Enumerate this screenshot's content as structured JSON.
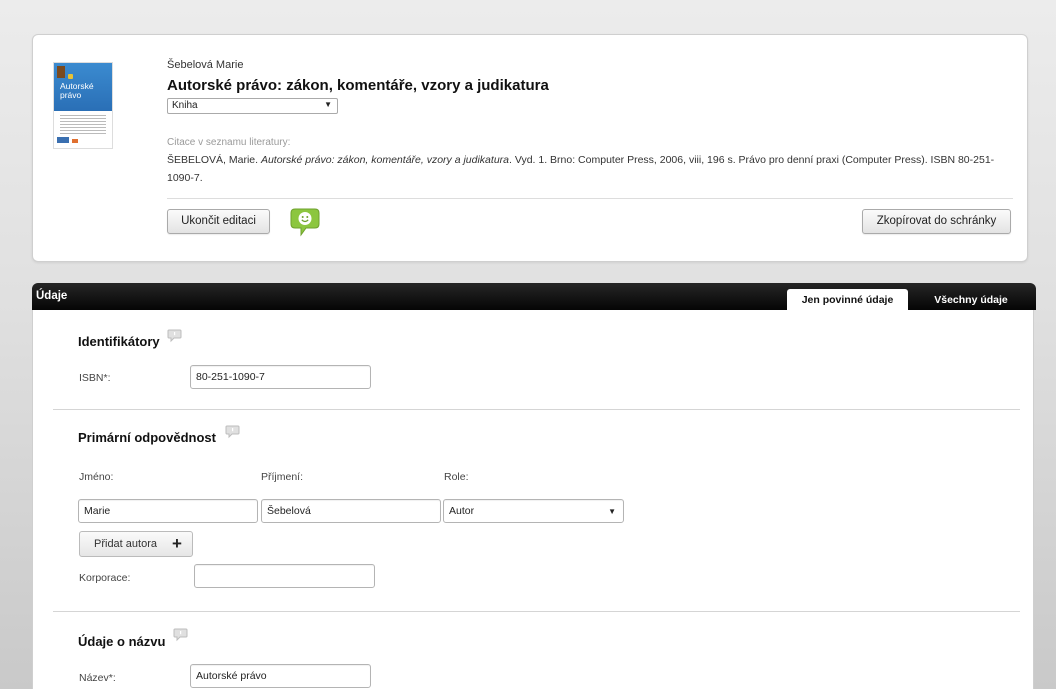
{
  "record": {
    "author": "Šebelová Marie",
    "title": "Autorské právo: zákon, komentáře, vzory a judikatura",
    "type_value": "Kniha",
    "cover_text": "Autorské právo",
    "citation_label": "Citace v seznamu literatury:",
    "citation_pre": "ŠEBELOVÁ, Marie. ",
    "citation_italic": "Autorské právo: zákon, komentáře, vzory a judikatura",
    "citation_post": ". Vyd. 1. Brno: Computer Press, 2006, viii, 196 s. Právo pro denní praxi (Computer Press). ISBN 80-251-1090-7.",
    "end_edit_label": "Ukončit editaci",
    "copy_label": "Zkopírovat do schránky"
  },
  "panel": {
    "title": "Údaje",
    "tabs": [
      "Jen povinné údaje",
      "Všechny údaje"
    ],
    "active_tab": "Jen povinné údaje"
  },
  "identifiers": {
    "title": "Identifikátory",
    "isbn_label": "ISBN*:",
    "isbn_value": "80-251-1090-7"
  },
  "responsibility": {
    "title": "Primární odpovědnost",
    "first_name_label": "Jméno:",
    "last_name_label": "Příjmení:",
    "role_label": "Role:",
    "first_name": "Marie",
    "last_name": "Šebelová",
    "role": "Autor",
    "add_author_label": "Přidat autora",
    "corporation_label": "Korporace:",
    "corporation_value": ""
  },
  "title_data": {
    "title": "Údaje o názvu",
    "name_label": "Název*:",
    "name_value": "Autorské právo"
  },
  "icons": {
    "comment": "smiley-comment-icon",
    "help": "help-speech-icon",
    "add": "plus-icon",
    "dropdown": "chevron-down-icon"
  },
  "colors": {
    "comment_green": "#8cc63f",
    "header_black": "#111111",
    "cover_blue": "#2f7cc4"
  }
}
